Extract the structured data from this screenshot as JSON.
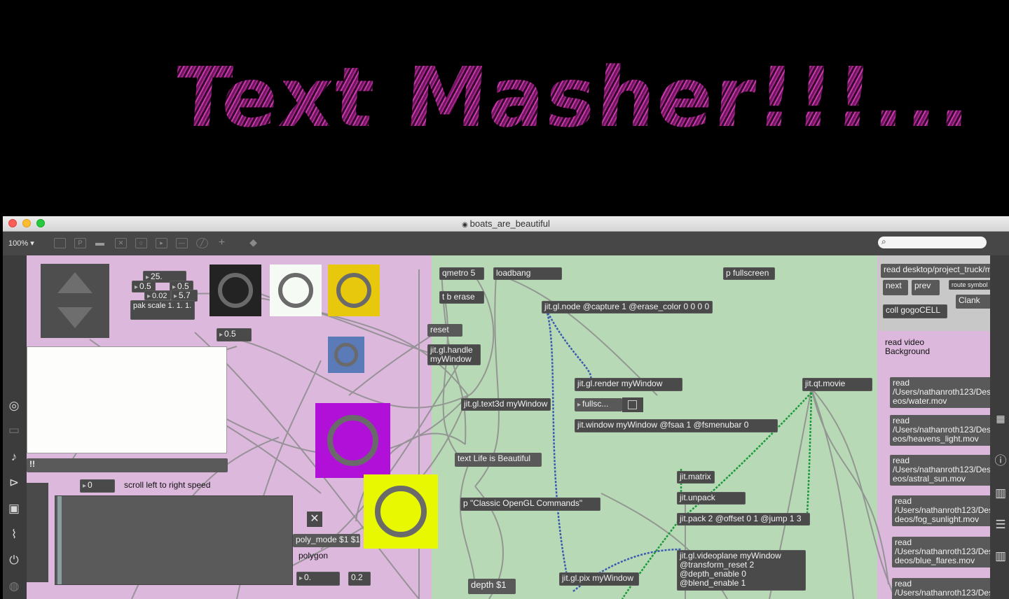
{
  "render": {
    "text": "Text Masher!!!..."
  },
  "window": {
    "title": "boats_are_beautiful",
    "zoom": "100% ▾"
  },
  "toolbar": {
    "icons": [
      "presentation-icon",
      "patcher-icon",
      "comment-icon",
      "close-box-icon",
      "object-box-icon",
      "play-icon",
      "split-icon",
      "clock-icon",
      "add-icon",
      "paint-bucket-icon"
    ]
  },
  "sidebar": {
    "icons": [
      "target-icon",
      "inspector-icon",
      "music-note-icon",
      "media-icon",
      "image-icon",
      "paperclip-icon",
      "plug-icon",
      "help-icon"
    ]
  },
  "colors": {
    "pink": "#dcb8dc",
    "green": "#b8d9b6",
    "object": "#4a4a4a",
    "cord": "#8c8c8c",
    "cord_blue": "#3a5ab0",
    "cord_green": "#1a9a3a"
  },
  "pink_objects": {
    "num_25": "25.",
    "num_05a": "0.5",
    "num_002": "0.02",
    "num_05b": "0.5",
    "num_57": "5.7",
    "pak": "pak scale 1. 1. 1.",
    "num_05c": "0.5",
    "bang_label": "!!",
    "scroll_num": "0",
    "scroll_label": "scroll left to right speed",
    "poly_mode": "poly_mode $1 $1",
    "polygon": "polygon",
    "num_0": "0.",
    "num_02": "0.2"
  },
  "green_objects": {
    "qmetro": "qmetro 5",
    "loadbang": "loadbang",
    "fullscreen": "p fullscreen",
    "tb_erase": "t b erase",
    "jit_node": "jit.gl.node @capture 1 @erase_color 0 0 0 0",
    "reset": "reset",
    "handle": "jit.gl.handle myWindow",
    "render": "jit.gl.render myWindow",
    "qtmovie": "jit.qt.movie",
    "text3d": "jit.gl.text3d myWindow",
    "fullsc": "fullsc...",
    "jit_window": "jit.window myWindow @fsaa 1 @fsmenubar 0",
    "text_life": "text Life is Beautiful",
    "matrix": "jit.matrix",
    "unpack": "jit.unpack",
    "classic": "p \"Classic OpenGL Commands\"",
    "pack": "jit.pack 2 @offset 0 1 @jump 1 3",
    "videoplane": "jit.gl.videoplane myWindow @transform_reset 2 @depth_enable 0 @blend_enable 1",
    "pix": "jit.gl.pix myWindow",
    "depth": "depth $1"
  },
  "right_objects": {
    "read_desktop": "read desktop/project_truck/m",
    "next": "next",
    "prev": "prev",
    "route": "route symbol",
    "clank": "Clank",
    "coll": "coll gogoCELL",
    "bg_label": "read video Background",
    "reads": [
      "read /Users/nathanroth123/Des eos/water.mov",
      "read /Users/nathanroth123/Des eos/heavens_light.mov",
      "read /Users/nathanroth123/Des eos/astral_sun.mov",
      "read /Users/nathanroth123/Des deos/fog_sunlight.mov",
      "read /Users/nathanroth123/Des deos/blue_flares.mov",
      "read /Users/nathanroth123/Des"
    ]
  }
}
